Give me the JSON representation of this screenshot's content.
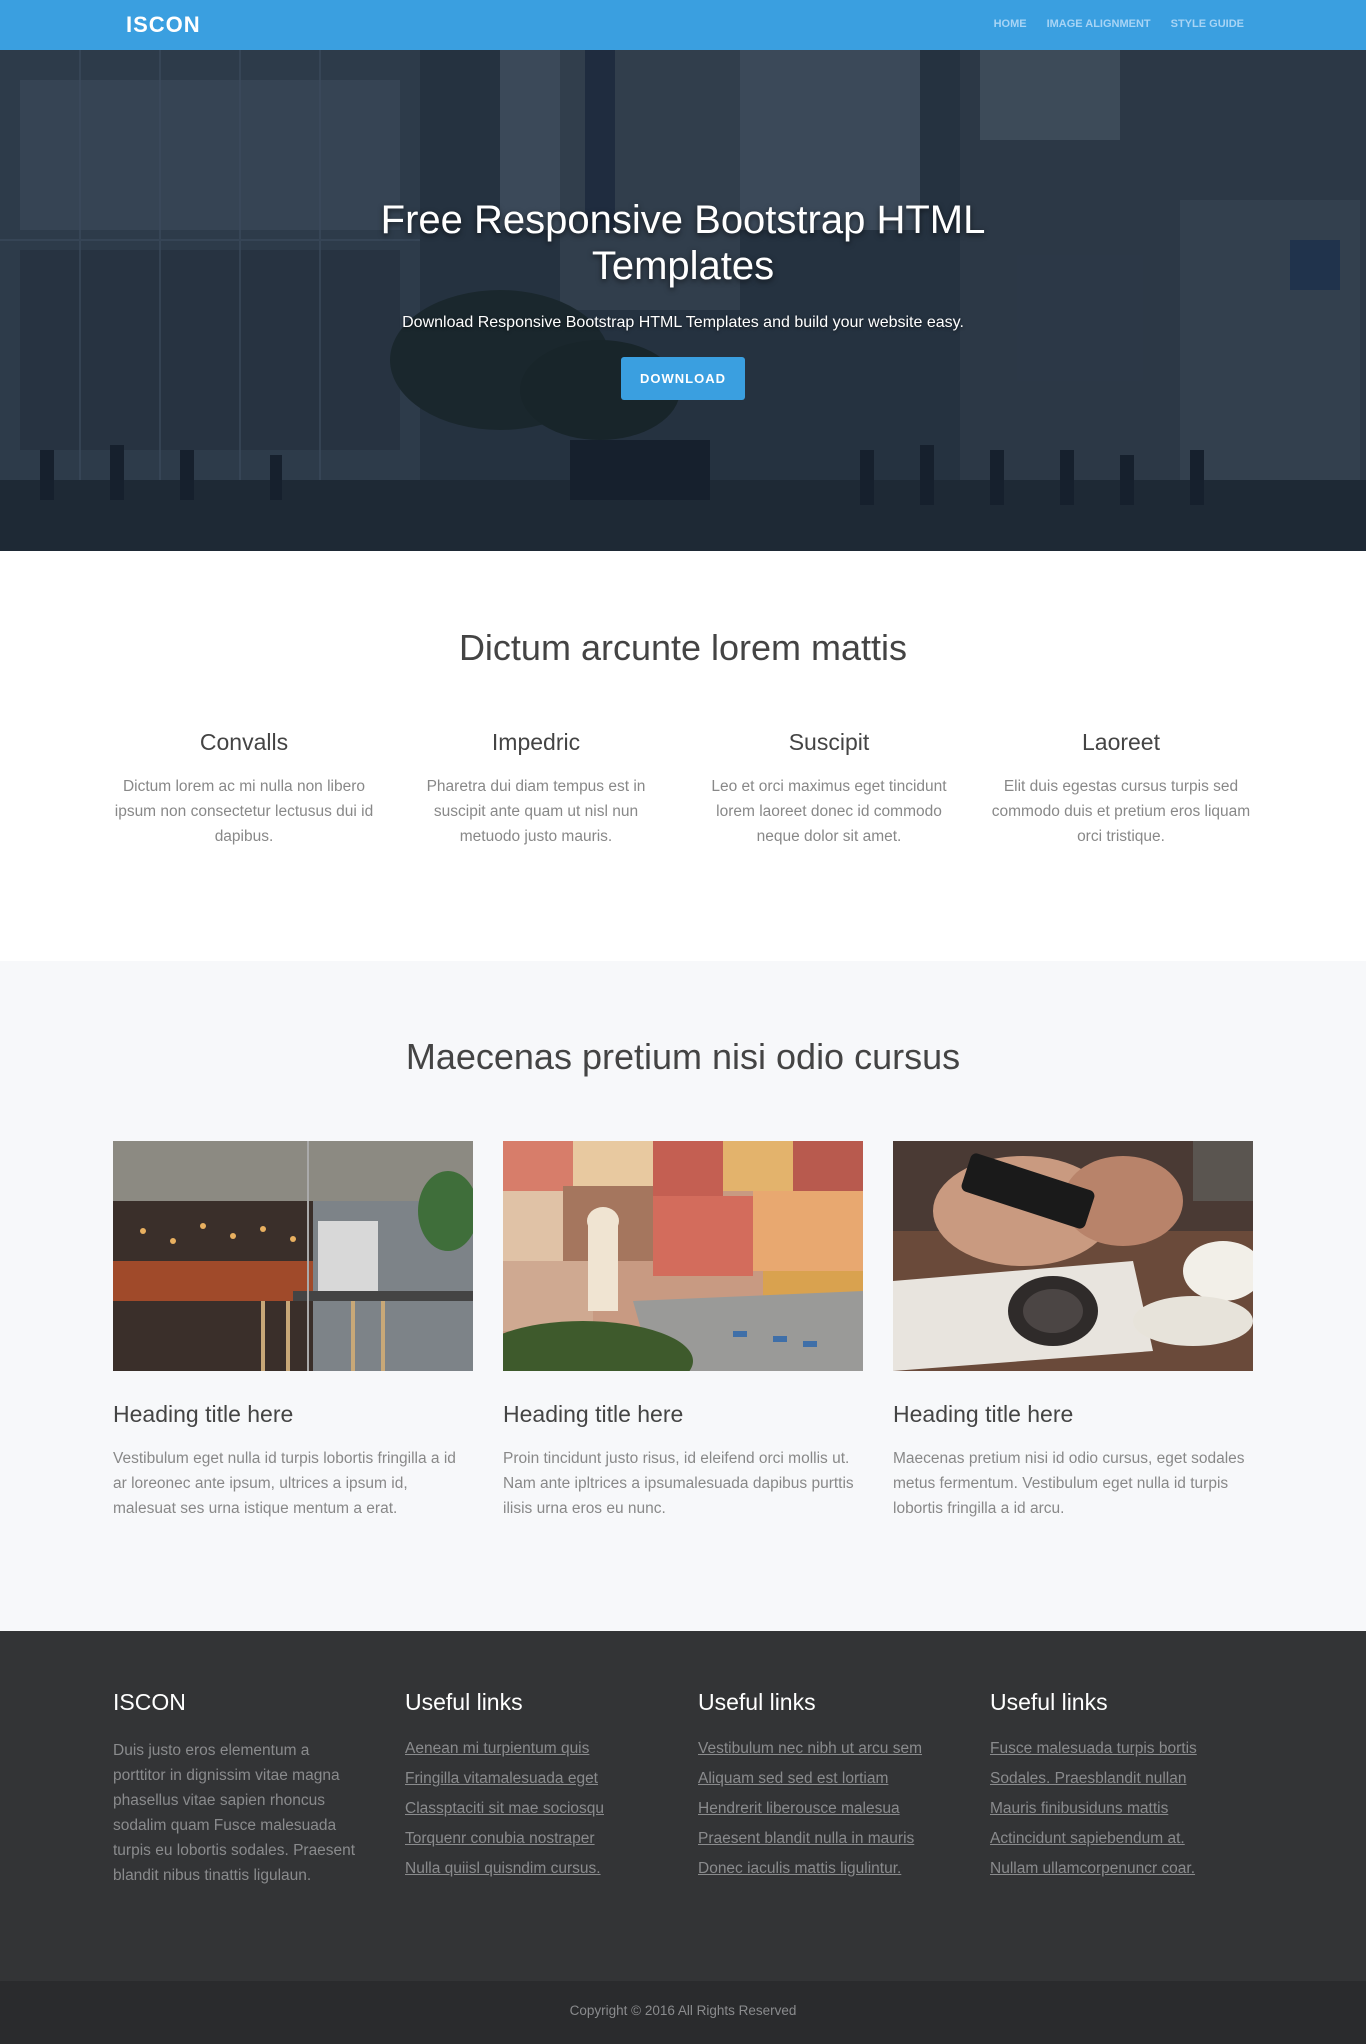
{
  "nav": {
    "brand": "ISCON",
    "links": [
      "HOME",
      "IMAGE ALIGNMENT",
      "STYLE GUIDE"
    ]
  },
  "hero": {
    "title": "Free Responsive Bootstrap HTML Templates",
    "subtitle": "Download Responsive Bootstrap HTML Templates and build your website easy.",
    "button": "DOWNLOAD"
  },
  "features": {
    "title": "Dictum arcunte lorem mattis",
    "items": [
      {
        "heading": "Convalls",
        "text": "Dictum lorem ac mi nulla non libero ipsum non consectetur lectusus dui id dapibus."
      },
      {
        "heading": "Impedric",
        "text": "Pharetra dui diam tempus est in suscipit ante quam ut nisl nun metuodo justo mauris."
      },
      {
        "heading": "Suscipit",
        "text": "Leo et orci maximus eget tincidunt lorem laoreet donec id commodo neque dolor sit amet."
      },
      {
        "heading": "Laoreet",
        "text": "Elit duis egestas cursus turpis sed commodo duis et pretium eros liquam orci tristique."
      }
    ]
  },
  "cards": {
    "title": "Maecenas pretium nisi odio cursus",
    "items": [
      {
        "heading": "Heading title here",
        "text": "Vestibulum eget nulla id turpis lobortis fringilla a id ar loreonec ante ipsum, ultrices a ipsum id, malesuat ses urna istique mentum a erat."
      },
      {
        "heading": "Heading title here",
        "text": "Proin tincidunt justo risus, id eleifend orci mollis ut. Nam ante ipltrices a ipsumalesuada dapibus purttis ilisis urna eros eu nunc."
      },
      {
        "heading": "Heading title here",
        "text": "Maecenas pretium nisi id odio cursus, eget sodales metus fermentum. Vestibulum eget nulla id turpis lobortis fringilla a id arcu."
      }
    ]
  },
  "footer": {
    "about": {
      "heading": "ISCON",
      "text": "Duis justo eros elementum a porttitor in dignissim vitae magna phasellus vitae sapien rhoncus sodalim quam Fusce malesuada turpis eu lobortis sodales. Praesent blandit nibus tinattis ligulaun."
    },
    "columns": [
      {
        "heading": "Useful links",
        "links": [
          "Aenean mi turpientum quis",
          "Fringilla vitamalesuada eget",
          "Classptaciti sit mae sociosqu",
          "Torquenr conubia nostraper",
          "Nulla quiisl quisndim cursus."
        ]
      },
      {
        "heading": "Useful links",
        "links": [
          "Vestibulum nec nibh ut arcu sem",
          "Aliquam sed sed est lortiam",
          "Hendrerit liberousce malesua",
          "Praesent blandit nulla in mauris",
          "Donec iaculis mattis ligulintur."
        ]
      },
      {
        "heading": "Useful links",
        "links": [
          "Fusce malesuada turpis bortis",
          "Sodales. Praesblandit nullan",
          "Mauris finibusiduns mattis",
          "Actincidunt sapiebendum at.",
          "Nullam ullamcorpenuncr coar."
        ]
      }
    ],
    "copyright": "Copyright © 2016 All Rights Reserved"
  },
  "colors": {
    "primary": "#3a9fe0",
    "footer_bg": "#333436",
    "copyright_bg": "#2a2b2d",
    "section_alt_bg": "#f7f8fa"
  }
}
